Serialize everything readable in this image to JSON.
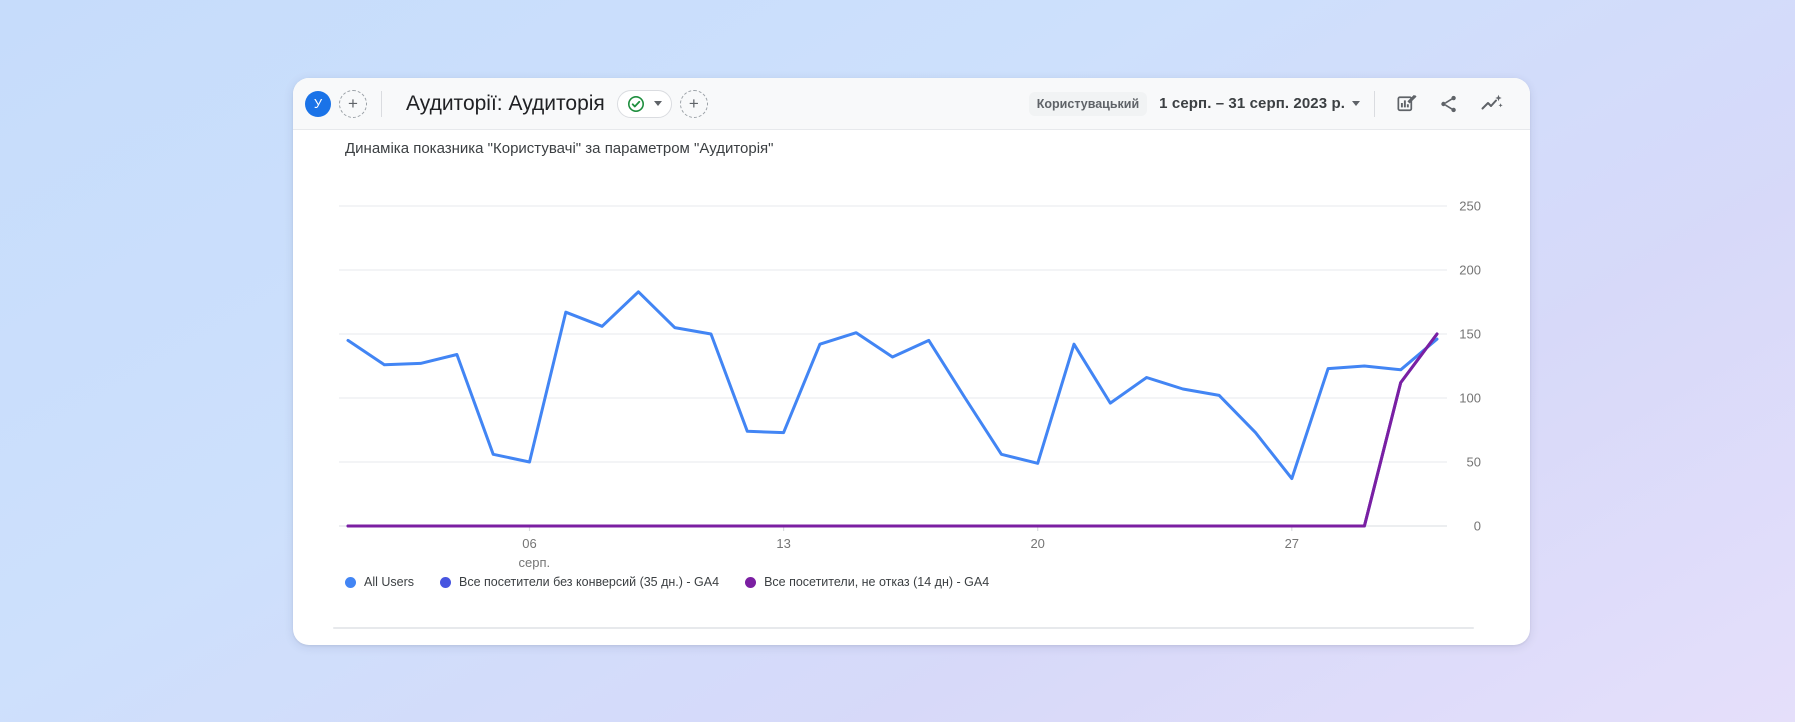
{
  "header": {
    "avatar_letter": "У",
    "title": "Аудиторії: Аудиторія",
    "add_icon": "+",
    "custom_badge": "Користувацький",
    "date_range": "1 серп. – 31 серп. 2023 р."
  },
  "chart_data": {
    "type": "line",
    "title": "Динаміка показника \"Користувачі\" за параметром \"Аудиторія\"",
    "x_axis": {
      "unit": "days of August 2023",
      "range": [
        1,
        31
      ],
      "ticks": [
        {
          "day": 6,
          "label": "06",
          "sublabel": "серп."
        },
        {
          "day": 13,
          "label": "13"
        },
        {
          "day": 20,
          "label": "20"
        },
        {
          "day": 27,
          "label": "27"
        }
      ]
    },
    "y_axis": {
      "min": 0,
      "max": 250,
      "ticks": [
        0,
        50,
        100,
        150,
        200,
        250
      ],
      "position": "right"
    },
    "grid": true,
    "legend_position": "bottom",
    "series": [
      {
        "name": "All Users",
        "color": "#4285F4",
        "values": [
          145,
          126,
          127,
          134,
          56,
          50,
          167,
          156,
          183,
          155,
          150,
          74,
          73,
          142,
          151,
          132,
          145,
          100,
          56,
          49,
          142,
          96,
          116,
          107,
          102,
          73,
          37,
          123,
          125,
          122,
          146
        ]
      },
      {
        "name": "Все посетители без конверсий (35 дн.) - GA4",
        "color": "#4755E0",
        "values": [
          0,
          0,
          0,
          0,
          0,
          0,
          0,
          0,
          0,
          0,
          0,
          0,
          0,
          0,
          0,
          0,
          0,
          0,
          0,
          0,
          0,
          0,
          0,
          0,
          0,
          0,
          0,
          0,
          0,
          112,
          150
        ]
      },
      {
        "name": "Все посетители, не отказ (14 дн) - GA4",
        "color": "#7B1FA2",
        "values": [
          0,
          0,
          0,
          0,
          0,
          0,
          0,
          0,
          0,
          0,
          0,
          0,
          0,
          0,
          0,
          0,
          0,
          0,
          0,
          0,
          0,
          0,
          0,
          0,
          0,
          0,
          0,
          0,
          0,
          112,
          150
        ]
      }
    ]
  },
  "colors": {
    "accent_blue": "#1a73e8",
    "icon_gray": "#5f6368",
    "check_green": "#1e8e3e"
  }
}
